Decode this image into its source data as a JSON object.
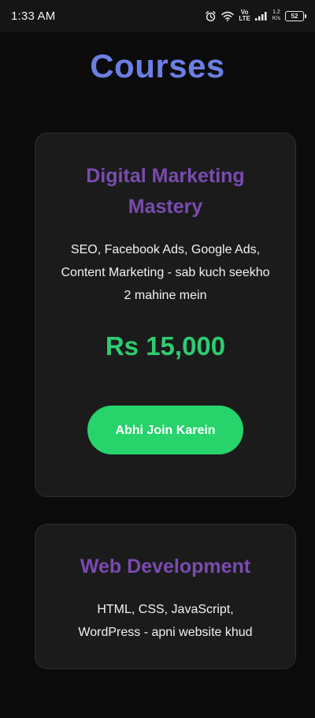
{
  "status_bar": {
    "time": "1:33 AM",
    "network_label_top": "Vo",
    "network_label_bottom": "LTE",
    "speed_top": "1.2",
    "speed_bottom": "K/s",
    "battery": "52",
    "icons": [
      "alarm-icon",
      "wifi-icon",
      "volte-indicator",
      "signal-icon",
      "battery-icon"
    ]
  },
  "page": {
    "title": "Courses",
    "title_color": "#6b7fe3"
  },
  "courses": [
    {
      "title": "Digital Marketing Mastery",
      "description": "SEO, Facebook Ads, Google Ads, Content Marketing - sab kuch seekho 2 mahine mein",
      "price": "Rs 15,000",
      "button_label": "Abhi Join Karein"
    },
    {
      "title": "Web Development",
      "description": "HTML, CSS, JavaScript, WordPress - apni website khud"
    }
  ],
  "colors": {
    "background": "#0b0b0b",
    "card": "#1b1b1b",
    "course_title": "#7a4bb0",
    "price": "#2ecc71",
    "button": "#27d36b"
  }
}
